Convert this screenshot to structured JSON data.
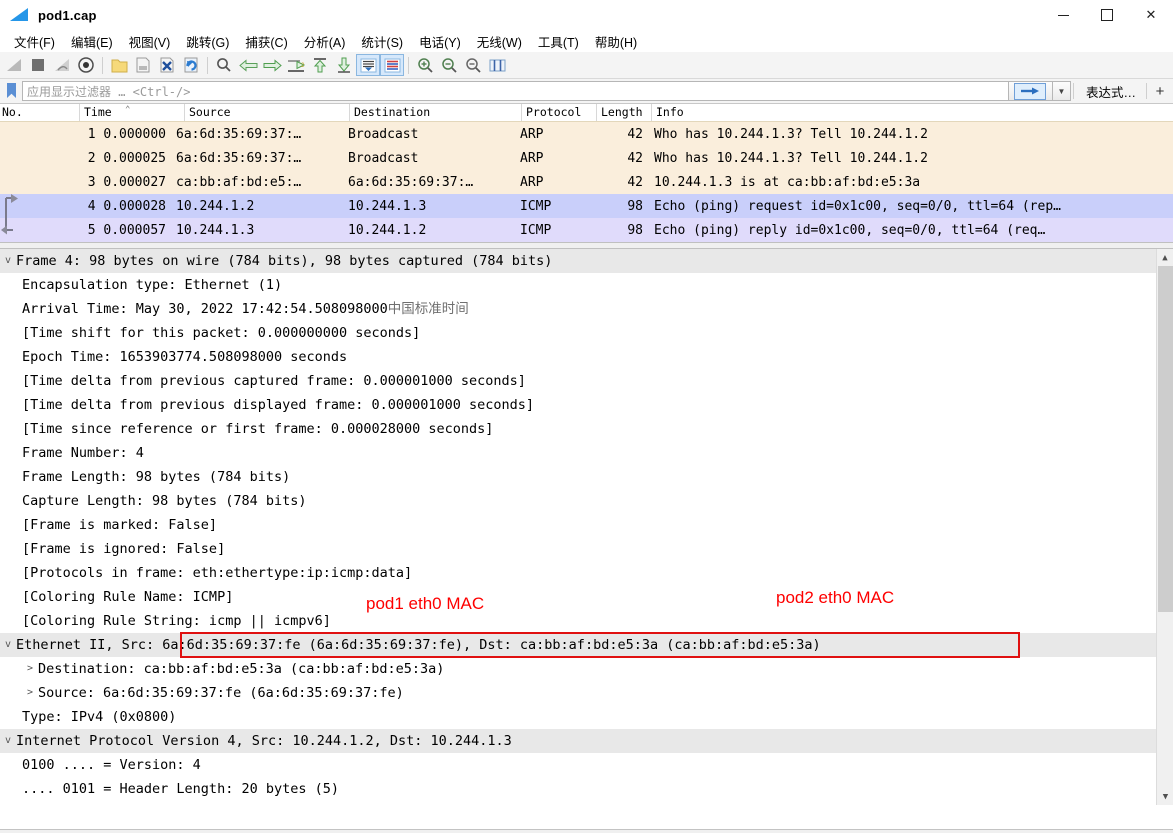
{
  "window": {
    "title": "pod1.cap",
    "app_icon": "wireshark-fin-icon",
    "controls": {
      "minimize": "minimize-icon",
      "maximize": "maximize-icon",
      "close": "close-icon"
    }
  },
  "menubar": {
    "items": [
      {
        "label": "文件(F)",
        "name": "menu-file"
      },
      {
        "label": "编辑(E)",
        "name": "menu-edit"
      },
      {
        "label": "视图(V)",
        "name": "menu-view"
      },
      {
        "label": "跳转(G)",
        "name": "menu-go"
      },
      {
        "label": "捕获(C)",
        "name": "menu-capture"
      },
      {
        "label": "分析(A)",
        "name": "menu-analyze"
      },
      {
        "label": "统计(S)",
        "name": "menu-statistics"
      },
      {
        "label": "电话(Y)",
        "name": "menu-telephony"
      },
      {
        "label": "无线(W)",
        "name": "menu-wireless"
      },
      {
        "label": "工具(T)",
        "name": "menu-tools"
      },
      {
        "label": "帮助(H)",
        "name": "menu-help"
      }
    ]
  },
  "toolbar": {
    "icons": [
      "start-capture-icon",
      "stop-capture-icon",
      "restart-capture-icon",
      "capture-options-icon",
      "open-file-icon",
      "save-file-icon",
      "close-file-icon",
      "reload-file-icon",
      "find-packet-icon",
      "go-back-icon",
      "go-forward-icon",
      "go-to-packet-icon",
      "go-to-first-icon",
      "go-to-last-icon",
      "auto-scroll-icon",
      "colorize-icon",
      "zoom-in-icon",
      "zoom-out-icon",
      "zoom-reset-icon",
      "resize-columns-icon"
    ]
  },
  "filter": {
    "bookmark_icon": "filter-bookmark-icon",
    "placeholder": "应用显示过滤器 … <Ctrl-/>",
    "value": "",
    "apply_icon": "apply-filter-arrow-icon",
    "dropdown_icon": "chevron-down-icon",
    "expression_label": "表达式…",
    "plus_label": "+"
  },
  "packet_list": {
    "columns": [
      {
        "label": "No.",
        "name": "column-no"
      },
      {
        "label": "Time",
        "name": "column-time"
      },
      {
        "label": "Source",
        "name": "column-source"
      },
      {
        "label": "Destination",
        "name": "column-destination"
      },
      {
        "label": "Protocol",
        "name": "column-protocol"
      },
      {
        "label": "Length",
        "name": "column-length"
      },
      {
        "label": "Info",
        "name": "column-info"
      }
    ],
    "sort_indicator": "⌃",
    "rows": [
      {
        "no": "1",
        "time": "0.000000",
        "source": "6a:6d:35:69:37:…",
        "destination": "Broadcast",
        "protocol": "ARP",
        "length": "42",
        "info": "Who has 10.244.1.3? Tell 10.244.1.2",
        "style": "arp"
      },
      {
        "no": "2",
        "time": "0.000025",
        "source": "6a:6d:35:69:37:…",
        "destination": "Broadcast",
        "protocol": "ARP",
        "length": "42",
        "info": "Who has 10.244.1.3? Tell 10.244.1.2",
        "style": "arp"
      },
      {
        "no": "3",
        "time": "0.000027",
        "source": "ca:bb:af:bd:e5:…",
        "destination": "6a:6d:35:69:37:…",
        "protocol": "ARP",
        "length": "42",
        "info": "10.244.1.3 is at ca:bb:af:bd:e5:3a",
        "style": "arp"
      },
      {
        "no": "4",
        "time": "0.000028",
        "source": "10.244.1.2",
        "destination": "10.244.1.3",
        "protocol": "ICMP",
        "length": "98",
        "info": "Echo (ping) request  id=0x1c00, seq=0/0, ttl=64 (rep…",
        "style": "sel-a"
      },
      {
        "no": "5",
        "time": "0.000057",
        "source": "10.244.1.3",
        "destination": "10.244.1.2",
        "protocol": "ICMP",
        "length": "98",
        "info": "Echo (ping) reply    id=0x1c00, seq=0/0, ttl=64 (req…",
        "style": "sel-b"
      }
    ]
  },
  "detail": {
    "rows": [
      {
        "twisty": "v",
        "indent": 0,
        "text": "Frame 4: 98 bytes on wire (784 bits), 98 bytes captured (784 bits)",
        "highlight": true,
        "name": "detail-frame"
      },
      {
        "twisty": "",
        "indent": 1,
        "text": "Encapsulation type: Ethernet (1)",
        "name": "detail-encap-type"
      },
      {
        "twisty": "",
        "indent": 1,
        "text": "Arrival Time: May 30, 2022 17:42:54.508098000 ",
        "cn": "中国标准时间",
        "name": "detail-arrival-time"
      },
      {
        "twisty": "",
        "indent": 1,
        "text": "[Time shift for this packet: 0.000000000 seconds]",
        "name": "detail-time-shift"
      },
      {
        "twisty": "",
        "indent": 1,
        "text": "Epoch Time: 1653903774.508098000 seconds",
        "name": "detail-epoch-time"
      },
      {
        "twisty": "",
        "indent": 1,
        "text": "[Time delta from previous captured frame: 0.000001000 seconds]",
        "name": "detail-delta-captured"
      },
      {
        "twisty": "",
        "indent": 1,
        "text": "[Time delta from previous displayed frame: 0.000001000 seconds]",
        "name": "detail-delta-displayed"
      },
      {
        "twisty": "",
        "indent": 1,
        "text": "[Time since reference or first frame: 0.000028000 seconds]",
        "name": "detail-time-since-ref"
      },
      {
        "twisty": "",
        "indent": 1,
        "text": "Frame Number: 4",
        "name": "detail-frame-number"
      },
      {
        "twisty": "",
        "indent": 1,
        "text": "Frame Length: 98 bytes (784 bits)",
        "name": "detail-frame-length"
      },
      {
        "twisty": "",
        "indent": 1,
        "text": "Capture Length: 98 bytes (784 bits)",
        "name": "detail-capture-length"
      },
      {
        "twisty": "",
        "indent": 1,
        "text": "[Frame is marked: False]",
        "name": "detail-frame-marked"
      },
      {
        "twisty": "",
        "indent": 1,
        "text": "[Frame is ignored: False]",
        "name": "detail-frame-ignored"
      },
      {
        "twisty": "",
        "indent": 1,
        "text": "[Protocols in frame: eth:ethertype:ip:icmp:data]",
        "name": "detail-protocols-in-frame"
      },
      {
        "twisty": "",
        "indent": 1,
        "text": "[Coloring Rule Name: ICMP]",
        "name": "detail-coloring-rule-name"
      },
      {
        "twisty": "",
        "indent": 1,
        "text": "[Coloring Rule String: icmp || icmpv6]",
        "name": "detail-coloring-rule-string"
      },
      {
        "twisty": "v",
        "indent": 0,
        "text": "Ethernet II, Src: 6a:6d:35:69:37:fe (6a:6d:35:69:37:fe), Dst: ca:bb:af:bd:e5:3a (ca:bb:af:bd:e5:3a)",
        "highlight": true,
        "name": "detail-ethernet-ii"
      },
      {
        "twisty": ">",
        "indent": 1,
        "text": "Destination: ca:bb:af:bd:e5:3a (ca:bb:af:bd:e5:3a)",
        "name": "detail-eth-destination"
      },
      {
        "twisty": ">",
        "indent": 1,
        "text": "Source: 6a:6d:35:69:37:fe (6a:6d:35:69:37:fe)",
        "name": "detail-eth-source"
      },
      {
        "twisty": "",
        "indent": 1,
        "text": "Type: IPv4 (0x0800)",
        "name": "detail-eth-type"
      },
      {
        "twisty": "v",
        "indent": 0,
        "text": "Internet Protocol Version 4, Src: 10.244.1.2, Dst: 10.244.1.3",
        "highlight": true,
        "name": "detail-ipv4"
      },
      {
        "twisty": "",
        "indent": 1,
        "text": "0100 .... = Version: 4",
        "name": "detail-ip-version"
      },
      {
        "twisty": "",
        "indent": 1,
        "text": ".... 0101 = Header Length: 20 bytes (5)",
        "name": "detail-ip-header-length"
      }
    ]
  },
  "annotations": [
    {
      "text": "pod1 eth0 MAC",
      "color": "#fe0000",
      "name": "annotation-pod1-mac"
    },
    {
      "text": "pod2 eth0 MAC",
      "color": "#fe0000",
      "name": "annotation-pod2-mac"
    }
  ],
  "scrollbar": {
    "up_icon": "scroll-up-arrow-icon",
    "down_icon": "scroll-down-arrow-icon"
  }
}
